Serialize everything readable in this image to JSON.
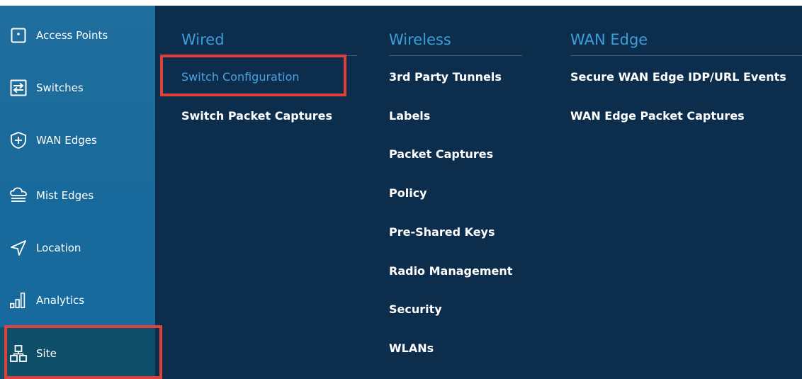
{
  "sidebar": {
    "items": [
      {
        "label": "Access Points",
        "icon": "access-point-icon"
      },
      {
        "label": "Switches",
        "icon": "switch-icon"
      },
      {
        "label": "WAN Edges",
        "icon": "wan-edge-icon"
      },
      {
        "label": "Mist Edges",
        "icon": "mist-edge-icon"
      },
      {
        "label": "Location",
        "icon": "location-arrow-icon"
      },
      {
        "label": "Analytics",
        "icon": "analytics-bars-icon"
      },
      {
        "label": "Site",
        "icon": "site-hierarchy-icon"
      }
    ],
    "selected": "Site"
  },
  "menu": {
    "wired": {
      "heading": "Wired",
      "links": [
        "Switch Configuration",
        "Switch Packet Captures"
      ]
    },
    "wireless": {
      "heading": "Wireless",
      "links": [
        "3rd Party Tunnels",
        "Labels",
        "Packet Captures",
        "Policy",
        "Pre-Shared Keys",
        "Radio Management",
        "Security",
        "WLANs"
      ]
    },
    "wan_edge": {
      "heading": "WAN Edge",
      "links": [
        "Secure WAN Edge IDP/URL Events",
        "WAN Edge Packet Captures"
      ]
    }
  },
  "colors": {
    "sidebar_bg": "#1a6a9b",
    "sidebar_selected_bg": "#0f4f69",
    "panel_bg": "#0d2d4d",
    "heading": "#3b9ed8",
    "active_link": "#4aa3dd",
    "highlight": "#e0403a"
  }
}
